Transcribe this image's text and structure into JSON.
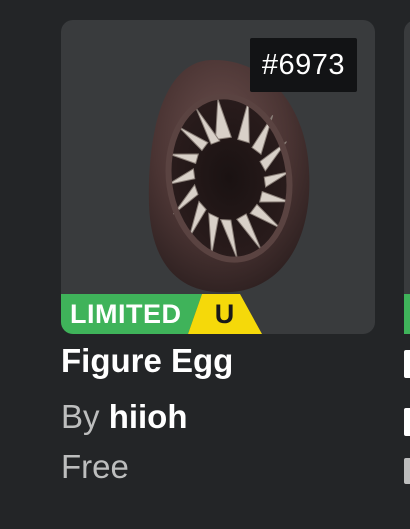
{
  "item": {
    "name": "Figure Egg",
    "serial": "#6973",
    "badge": {
      "limited": "LIMITED",
      "unique": "U"
    },
    "creator_prefix": "By",
    "creator_name": "hiioh",
    "price": "Free",
    "thumbnail_icon": "egg-icon"
  },
  "next_item": {
    "thumbnail_icon": "item-thumbnail"
  },
  "colors": {
    "background": "#232527",
    "card": "#393b3d",
    "limited_green": "#3fb35a",
    "unique_yellow": "#f5d90a",
    "serial_bg": "#121315",
    "muted_text": "#bdbebe"
  }
}
